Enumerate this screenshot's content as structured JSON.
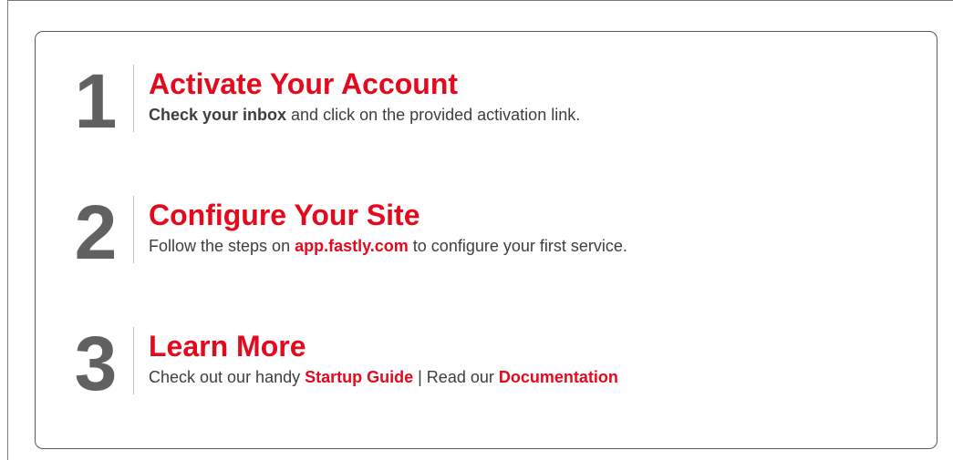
{
  "steps": [
    {
      "number": "1",
      "title": "Activate Your Account",
      "desc_bold": "Check your inbox",
      "desc_rest": " and click on the provided activation link."
    },
    {
      "number": "2",
      "title": "Configure Your Site",
      "desc_before": "Follow the steps on ",
      "link": "app.fastly.com",
      "desc_after": " to configure your first service."
    },
    {
      "number": "3",
      "title": "Learn More",
      "desc_before": "Check out our handy ",
      "link1": "Startup Guide",
      "separator": " | Read our ",
      "link2": "Documentation"
    }
  ],
  "colors": {
    "accent": "#e5091d",
    "number": "#616161",
    "text": "#3e3e3e"
  }
}
